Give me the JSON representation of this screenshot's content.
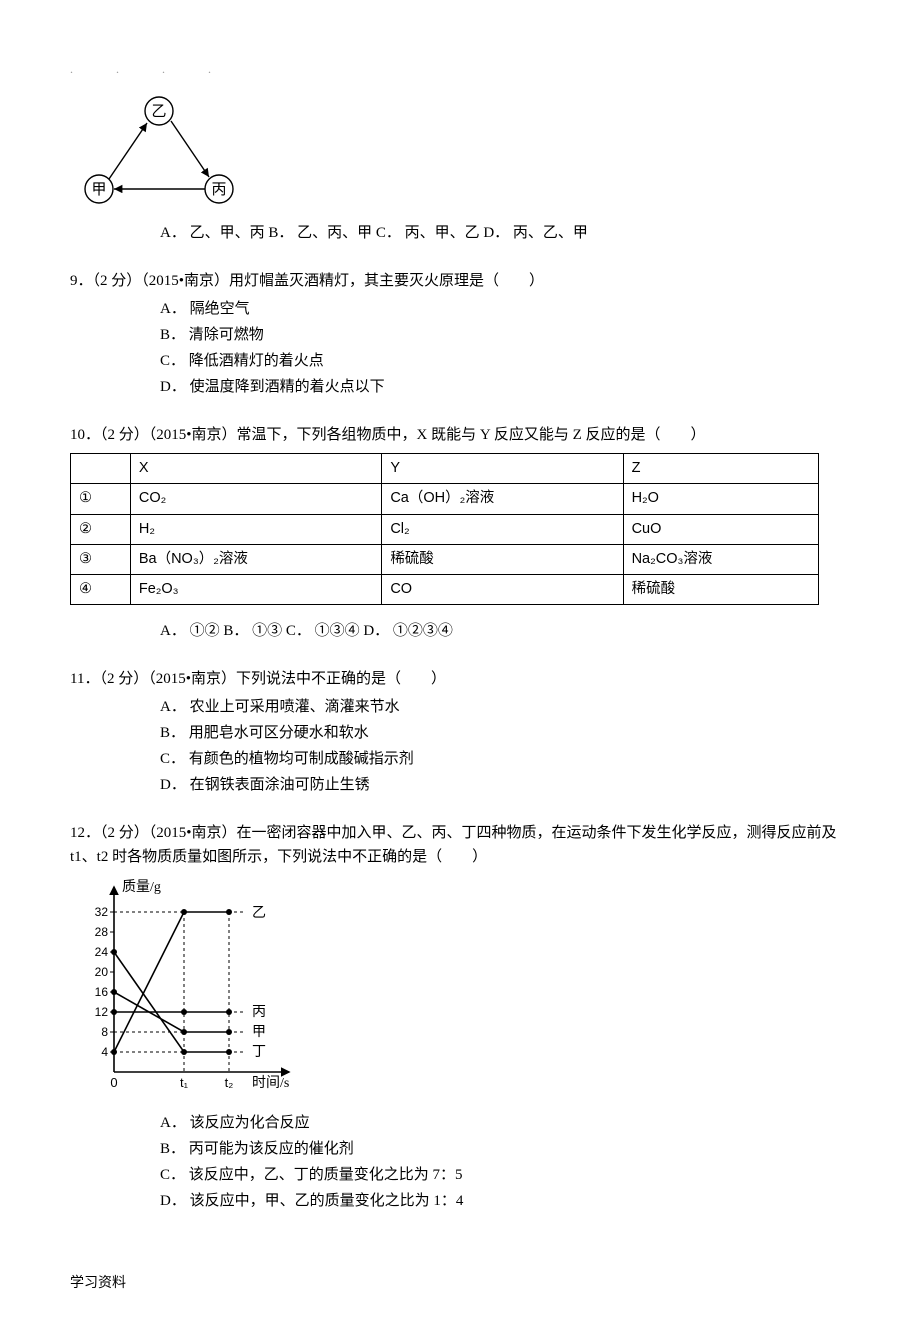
{
  "header_dots": ".        .   .          .",
  "q8": {
    "diagram_nodes": {
      "top": "乙",
      "left": "甲",
      "right": "丙"
    },
    "options_line": "A． 乙、甲、丙  B． 乙、丙、甲  C． 丙、甲、乙  D． 丙、乙、甲"
  },
  "q9": {
    "stem": "9．（2 分）（2015•南京）用灯帽盖灭酒精灯，其主要灭火原理是（　　）",
    "opts": {
      "a": "A． 隔绝空气",
      "b": "B． 清除可燃物",
      "c": "C． 降低酒精灯的着火点",
      "d": "D． 使温度降到酒精的着火点以下"
    }
  },
  "q10": {
    "stem": "10．（2 分）（2015•南京）常温下，下列各组物质中，X 既能与 Y 反应又能与 Z 反应的是（　　）",
    "headers": {
      "c0": "",
      "c1": "X",
      "c2": "Y",
      "c3": "Z"
    },
    "rows": [
      {
        "idx": "①",
        "x": "CO₂",
        "y": "Ca（OH）₂溶液",
        "z": "H₂O"
      },
      {
        "idx": "②",
        "x": "H₂",
        "y": "Cl₂",
        "z": "CuO"
      },
      {
        "idx": "③",
        "x": "Ba（NO₃）₂溶液",
        "y": "稀硫酸",
        "z": "Na₂CO₃溶液"
      },
      {
        "idx": "④",
        "x": "Fe₂O₃",
        "y": "CO",
        "z": "稀硫酸"
      }
    ],
    "options_line": "A． ①②   B． ①③    C． ①③④  D． ①②③④"
  },
  "q11": {
    "stem": "11．（2 分）（2015•南京）下列说法中不正确的是（　　）",
    "opts": {
      "a": "A． 农业上可采用喷灌、滴灌来节水",
      "b": "B． 用肥皂水可区分硬水和软水",
      "c": "C． 有颜色的植物均可制成酸碱指示剂",
      "d": "D． 在钢铁表面涂油可防止生锈"
    }
  },
  "q12": {
    "stem": "12．（2 分）（2015•南京）在一密闭容器中加入甲、乙、丙、丁四种物质，在运动条件下发生化学反应，测得反应前及 t1、t2 时各物质质量如图所示，下列说法中不正确的是（　　）",
    "chart": {
      "ylabel": "质量/g",
      "xlabel": "时间/s",
      "y_ticks": [
        "32",
        "28",
        "24",
        "20",
        "16",
        "12",
        "8",
        "4"
      ],
      "x_ticks": [
        "0",
        "t₁",
        "t₂"
      ],
      "series_labels": {
        "yi": "乙",
        "bing": "丙",
        "jia": "甲",
        "ding": "丁"
      }
    },
    "opts": {
      "a": "A． 该反应为化合反应",
      "b": "B． 丙可能为该反应的催化剂",
      "c": "C． 该反应中，乙、丁的质量变化之比为 7：5",
      "d": "D． 该反应中，甲、乙的质量变化之比为 1：4"
    }
  },
  "footer": "学习资料",
  "chart_data": {
    "type": "line",
    "title": "",
    "xlabel": "时间/s",
    "ylabel": "质量/g",
    "x": [
      "0",
      "t1",
      "t2"
    ],
    "series": [
      {
        "name": "甲",
        "values": [
          16,
          8,
          8
        ]
      },
      {
        "name": "乙",
        "values": [
          4,
          32,
          32
        ]
      },
      {
        "name": "丙",
        "values": [
          12,
          12,
          12
        ]
      },
      {
        "name": "丁",
        "values": [
          24,
          4,
          4
        ]
      }
    ],
    "ylim": [
      0,
      32
    ],
    "y_ticks": [
      4,
      8,
      12,
      16,
      20,
      24,
      28,
      32
    ]
  }
}
